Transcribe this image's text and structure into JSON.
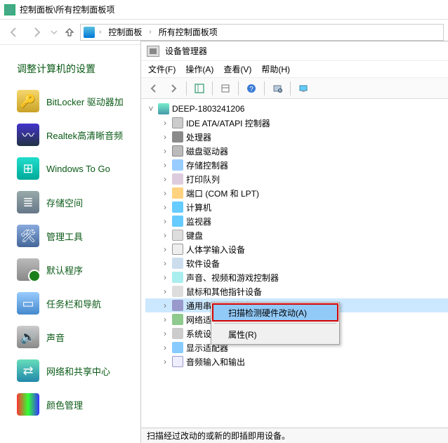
{
  "window": {
    "title": "控制面板\\所有控制面板项"
  },
  "breadcrumb": {
    "level1": "控制面板",
    "level2": "所有控制面板项"
  },
  "heading": "调整计算机的设置",
  "cp_items": [
    {
      "name": "bitlocker",
      "label": "BitLocker 驱动器加"
    },
    {
      "name": "realtek",
      "label": "Realtek高清晰音频"
    },
    {
      "name": "windows-to-go",
      "label": "Windows To Go"
    },
    {
      "name": "storage-spaces",
      "label": "存储空间"
    },
    {
      "name": "admin-tools",
      "label": "管理工具"
    },
    {
      "name": "default-programs",
      "label": "默认程序"
    },
    {
      "name": "taskbar-nav",
      "label": "任务栏和导航"
    },
    {
      "name": "sound",
      "label": "声音"
    },
    {
      "name": "network-sharing",
      "label": "网络和共享中心"
    },
    {
      "name": "color-mgmt",
      "label": "颜色管理"
    }
  ],
  "devmgr": {
    "title": "设备管理器",
    "menu": {
      "file": "文件(F)",
      "action": "操作(A)",
      "view": "查看(V)",
      "help": "帮助(H)"
    },
    "root": "DEEP-1803241206",
    "nodes": [
      {
        "name": "ide-atapi",
        "label": "IDE ATA/ATAPI 控制器"
      },
      {
        "name": "processors",
        "label": "处理器"
      },
      {
        "name": "disk-drives",
        "label": "磁盘驱动器"
      },
      {
        "name": "storage-controllers",
        "label": "存储控制器"
      },
      {
        "name": "print-queues",
        "label": "打印队列"
      },
      {
        "name": "ports",
        "label": "端口 (COM 和 LPT)"
      },
      {
        "name": "computer",
        "label": "计算机"
      },
      {
        "name": "monitors",
        "label": "监视器"
      },
      {
        "name": "keyboards",
        "label": "键盘"
      },
      {
        "name": "hid",
        "label": "人体学输入设备"
      },
      {
        "name": "software-devices",
        "label": "软件设备"
      },
      {
        "name": "sound-video-game",
        "label": "声音、视频和游戏控制器"
      },
      {
        "name": "mice",
        "label": "鼠标和其他指针设备"
      },
      {
        "name": "usb-controllers",
        "label": "通用串行总线控制器"
      },
      {
        "name": "network-adapters",
        "label": "网络适"
      },
      {
        "name": "system-devices",
        "label": "系统设"
      },
      {
        "name": "display-adapters",
        "label": "显示适配器"
      },
      {
        "name": "audio-io",
        "label": "音频输入和输出"
      }
    ],
    "context_menu": {
      "scan": "扫描检测硬件改动(A)",
      "properties": "属性(R)"
    },
    "status": "扫描经过改动的或新的即插即用设备。"
  }
}
